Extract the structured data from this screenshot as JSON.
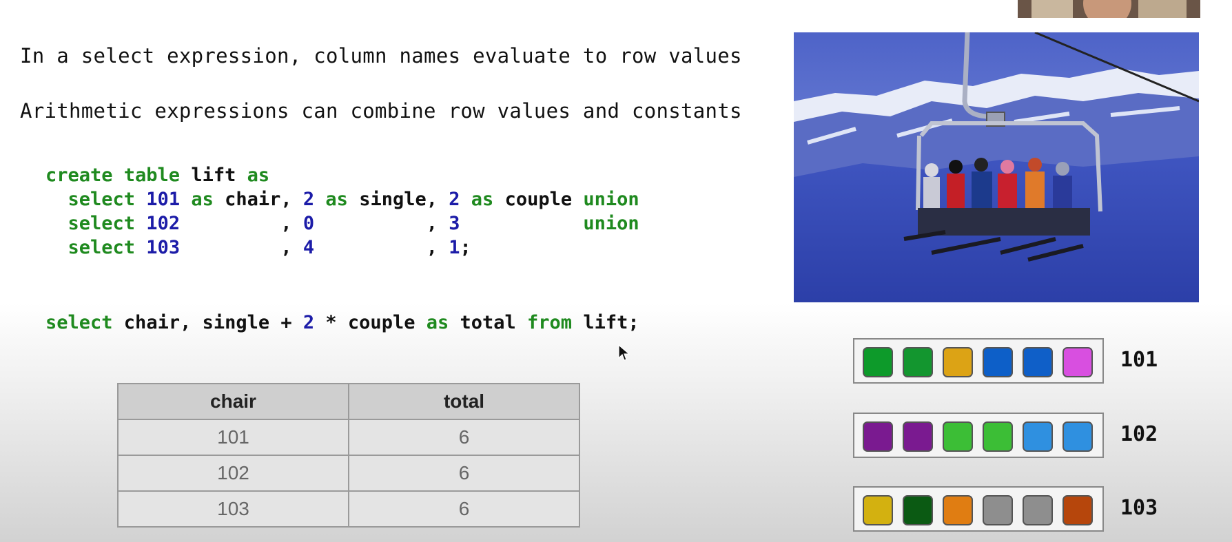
{
  "bullets": [
    "In a select expression, column names evaluate to row values",
    "Arithmetic expressions can combine row values and constants"
  ],
  "code": {
    "line1": {
      "t1": "create table",
      "t2": " lift ",
      "t3": "as"
    },
    "line2": {
      "a": "  select",
      "b": " 101",
      "c": " as",
      "d": " chair, ",
      "e": "2",
      "f": " as",
      "g": " single, ",
      "h": "2",
      "i": " as",
      "j": " couple ",
      "k": "union"
    },
    "line3": {
      "a": "  select",
      "b": " 102",
      "c": "         , ",
      "d": "0",
      "e": "          , ",
      "f": "3",
      "g": "           ",
      "h": "union"
    },
    "line4": {
      "a": "  select",
      "b": " 103",
      "c": "         , ",
      "d": "4",
      "e": "          , ",
      "f": "1",
      "g": ";"
    },
    "line5": {
      "a": "select",
      "b": " chair, single + ",
      "c": "2",
      "d": " * couple ",
      "e": "as",
      "f": " total ",
      "g": "from",
      "h": " lift;"
    }
  },
  "result_table": {
    "headers": [
      "chair",
      "total"
    ],
    "rows": [
      [
        "101",
        "6"
      ],
      [
        "102",
        "6"
      ],
      [
        "103",
        "6"
      ]
    ]
  },
  "chairs": [
    {
      "label": "101",
      "seats": [
        "#0d9a2a",
        "#13962f",
        "#dca315",
        "#0d5fc8",
        "#0f5fc8",
        "#d84fe0"
      ]
    },
    {
      "label": "102",
      "seats": [
        "#7a1a90",
        "#7a1a90",
        "#3cbe36",
        "#3cbe36",
        "#2f90e0",
        "#2f90e0"
      ]
    },
    {
      "label": "103",
      "seats": [
        "#d3b110",
        "#0b5a13",
        "#e07d12",
        "#8e8e8e",
        "#8e8e8e",
        "#b6460c"
      ]
    }
  ],
  "icons": {
    "cursor": "mouse-pointer-icon"
  }
}
